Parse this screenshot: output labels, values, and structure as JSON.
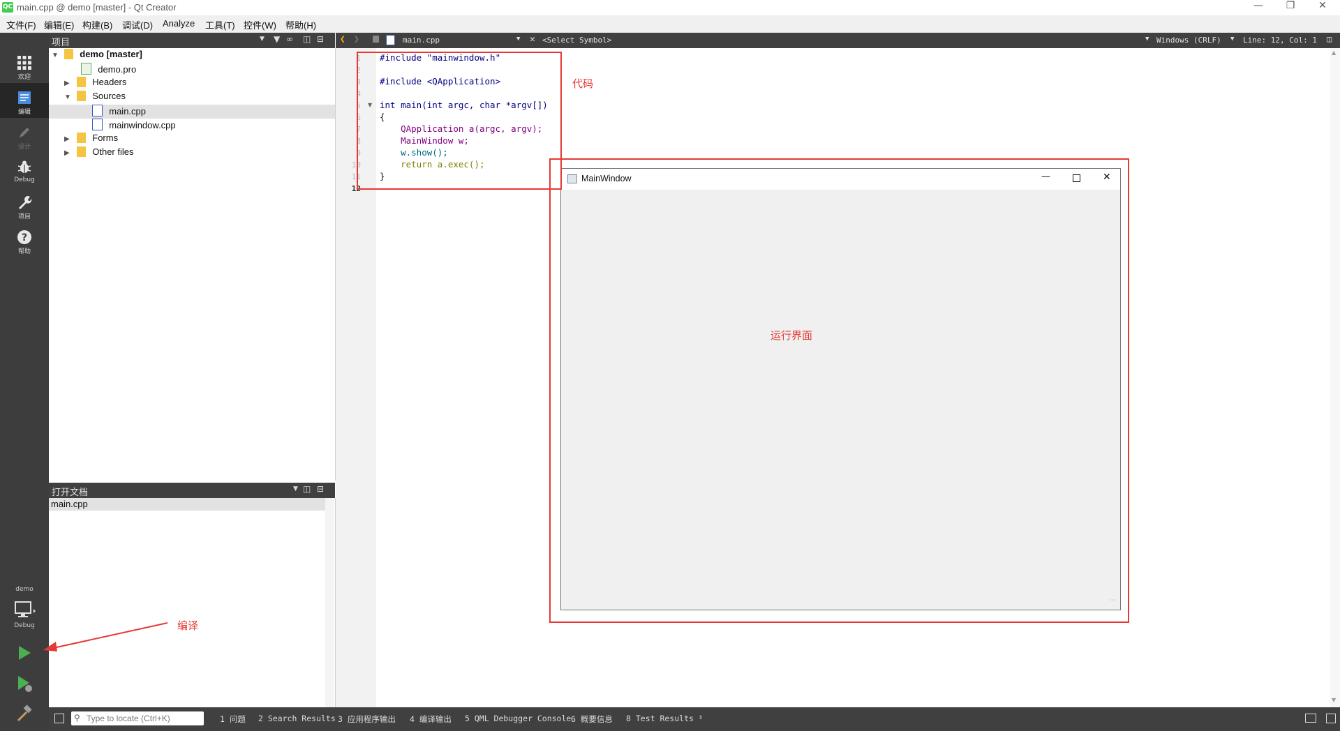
{
  "window": {
    "title": "main.cpp @ demo [master] - Qt Creator",
    "logo_text": "QC"
  },
  "menu": [
    "文件(F)",
    "编辑(E)",
    "构建(B)",
    "调试(D)",
    "Analyze",
    "工具(T)",
    "控件(W)",
    "帮助(H)"
  ],
  "modes": [
    {
      "label": "欢迎",
      "icon": "grid-icon"
    },
    {
      "label": "编辑",
      "icon": "edit-icon"
    },
    {
      "label": "设计",
      "icon": "pencil-icon"
    },
    {
      "label": "Debug",
      "icon": "bug-icon"
    },
    {
      "label": "项目",
      "icon": "wrench-icon"
    },
    {
      "label": "帮助",
      "icon": "help-icon"
    }
  ],
  "kit": {
    "project": "demo",
    "config": "Debug"
  },
  "project_pane": {
    "title": "项目",
    "tree": [
      {
        "label": "demo [master]",
        "bold": true
      },
      {
        "label": "demo.pro"
      },
      {
        "label": "Headers"
      },
      {
        "label": "Sources"
      },
      {
        "label": "main.cpp",
        "selected": true
      },
      {
        "label": "mainwindow.cpp"
      },
      {
        "label": "Forms"
      },
      {
        "label": "Other files"
      }
    ]
  },
  "open_docs": {
    "title": "打开文档",
    "items": [
      "main.cpp"
    ]
  },
  "editor": {
    "file": "main.cpp",
    "symbol": "<Select Symbol>",
    "line_ending": "Windows (CRLF)",
    "position": "Line: 12, Col: 1",
    "line_numbers": [
      "1",
      "2",
      "3",
      "4",
      "5",
      "6",
      "7",
      "8",
      "9",
      "10",
      "11",
      "12"
    ],
    "code": [
      "#include \"mainwindow.h\"",
      "",
      "#include <QApplication>",
      "",
      "int main(int argc, char *argv[])",
      "{",
      "    QApplication a(argc, argv);",
      "    MainWindow w;",
      "    w.show();",
      "    return a.exec();",
      "}",
      ""
    ]
  },
  "run_window": {
    "title": "MainWindow"
  },
  "annotations": {
    "code": "代码",
    "run": "运行界面",
    "build": "编译"
  },
  "status": {
    "locate_placeholder": "Type to locate (Ctrl+K)",
    "tabs": [
      "1 问题",
      "2 Search Results",
      "3 应用程序输出",
      "4 编译输出",
      "5 QML Debugger Console",
      "6 概要信息",
      "8 Test Results"
    ]
  },
  "colors": {
    "annotation": "#e53935",
    "mode_bar": "#3d3d3d",
    "run_green": "#4caf50"
  }
}
